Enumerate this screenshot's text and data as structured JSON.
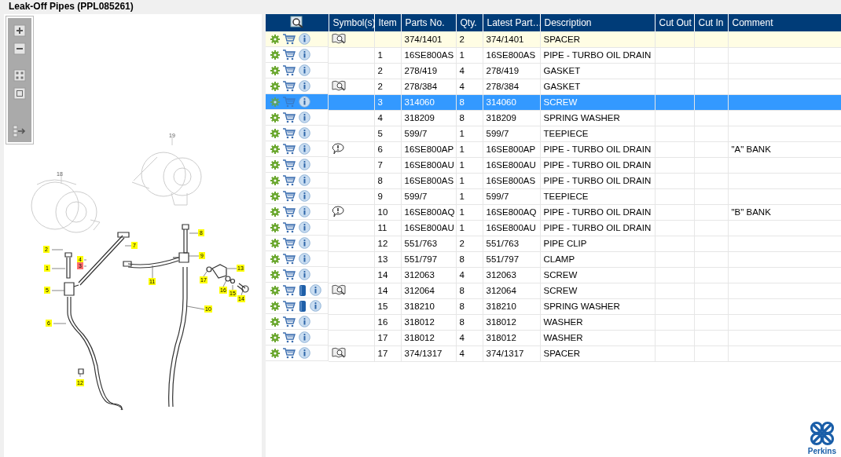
{
  "title": "Leak-Off Pipes (PPL085261)",
  "diagram": {
    "callouts": [
      {
        "label": "18",
        "highlighted": false,
        "selected": false
      },
      {
        "label": "19",
        "highlighted": false,
        "selected": false
      },
      {
        "label": "2",
        "highlighted": true,
        "selected": false
      },
      {
        "label": "4",
        "highlighted": true,
        "selected": false
      },
      {
        "label": "3",
        "highlighted": true,
        "selected": true
      },
      {
        "label": "1",
        "highlighted": true,
        "selected": false
      },
      {
        "label": "7",
        "highlighted": true,
        "selected": false
      },
      {
        "label": "5",
        "highlighted": true,
        "selected": false
      },
      {
        "label": "6",
        "highlighted": true,
        "selected": false
      },
      {
        "label": "12",
        "highlighted": true,
        "selected": false
      },
      {
        "label": "8",
        "highlighted": true,
        "selected": false
      },
      {
        "label": "9",
        "highlighted": true,
        "selected": false
      },
      {
        "label": "11",
        "highlighted": true,
        "selected": false
      },
      {
        "label": "13",
        "highlighted": true,
        "selected": false
      },
      {
        "label": "17",
        "highlighted": true,
        "selected": false
      },
      {
        "label": "16",
        "highlighted": true,
        "selected": false
      },
      {
        "label": "15",
        "highlighted": true,
        "selected": false
      },
      {
        "label": "14",
        "highlighted": true,
        "selected": false
      },
      {
        "label": "10",
        "highlighted": true,
        "selected": false
      }
    ]
  },
  "table": {
    "columns": [
      "Symbol(s)",
      "Item",
      "Parts No.",
      "Qty.",
      "Latest Part…",
      "Description",
      "Cut Out",
      "Cut In",
      "Comment"
    ],
    "rows": [
      {
        "highlighted": true,
        "selected": false,
        "manual": false,
        "symbols": [
          {
            "kind": "book"
          }
        ],
        "part_no": "374/1401",
        "qty": "2",
        "latest_part": "374/1401",
        "description": "SPACER"
      },
      {
        "highlighted": false,
        "selected": false,
        "manual": false,
        "item": "1",
        "part_no": "16SE800AS",
        "qty": "1",
        "latest_part": "16SE800AS",
        "description": "PIPE - TURBO OIL DRAIN"
      },
      {
        "highlighted": false,
        "selected": false,
        "manual": false,
        "item": "2",
        "part_no": "278/419",
        "qty": "4",
        "latest_part": "278/419",
        "description": "GASKET"
      },
      {
        "highlighted": false,
        "selected": false,
        "manual": false,
        "symbols": [
          {
            "kind": "book"
          }
        ],
        "item": "2",
        "part_no": "278/384",
        "qty": "4",
        "latest_part": "278/384",
        "description": "GASKET"
      },
      {
        "highlighted": false,
        "selected": true,
        "manual": false,
        "item": "3",
        "part_no": "314060",
        "qty": "8",
        "latest_part": "314060",
        "description": "SCREW"
      },
      {
        "highlighted": false,
        "selected": false,
        "manual": false,
        "item": "4",
        "part_no": "318209",
        "qty": "8",
        "latest_part": "318209",
        "description": "SPRING WASHER"
      },
      {
        "highlighted": false,
        "selected": false,
        "manual": false,
        "item": "5",
        "part_no": "599/7",
        "qty": "1",
        "latest_part": "599/7",
        "description": "TEEPIECE"
      },
      {
        "highlighted": false,
        "selected": false,
        "manual": false,
        "symbols": [
          {
            "kind": "note"
          }
        ],
        "item": "6",
        "part_no": "16SE800AP",
        "qty": "1",
        "latest_part": "16SE800AP",
        "description": "PIPE - TURBO OIL DRAIN",
        "comment": "\"A\" BANK"
      },
      {
        "highlighted": false,
        "selected": false,
        "manual": false,
        "item": "7",
        "part_no": "16SE800AU",
        "qty": "1",
        "latest_part": "16SE800AU",
        "description": "PIPE - TURBO OIL DRAIN"
      },
      {
        "highlighted": false,
        "selected": false,
        "manual": false,
        "item": "8",
        "part_no": "16SE800AS",
        "qty": "1",
        "latest_part": "16SE800AS",
        "description": "PIPE - TURBO OIL DRAIN"
      },
      {
        "highlighted": false,
        "selected": false,
        "manual": false,
        "item": "9",
        "part_no": "599/7",
        "qty": "1",
        "latest_part": "599/7",
        "description": "TEEPIECE"
      },
      {
        "highlighted": false,
        "selected": false,
        "manual": false,
        "symbols": [
          {
            "kind": "note"
          }
        ],
        "item": "10",
        "part_no": "16SE800AQ",
        "qty": "1",
        "latest_part": "16SE800AQ",
        "description": "PIPE - TURBO OIL DRAIN",
        "comment": "\"B\" BANK"
      },
      {
        "highlighted": false,
        "selected": false,
        "manual": false,
        "item": "11",
        "part_no": "16SE800AU",
        "qty": "1",
        "latest_part": "16SE800AU",
        "description": "PIPE - TURBO OIL DRAIN"
      },
      {
        "highlighted": false,
        "selected": false,
        "manual": false,
        "item": "12",
        "part_no": "551/763",
        "qty": "2",
        "latest_part": "551/763",
        "description": "PIPE CLIP"
      },
      {
        "highlighted": false,
        "selected": false,
        "manual": false,
        "item": "13",
        "part_no": "551/797",
        "qty": "8",
        "latest_part": "551/797",
        "description": "CLAMP"
      },
      {
        "highlighted": false,
        "selected": false,
        "manual": false,
        "item": "14",
        "part_no": "312063",
        "qty": "4",
        "latest_part": "312063",
        "description": "SCREW"
      },
      {
        "highlighted": false,
        "selected": false,
        "manual": true,
        "symbols": [
          {
            "kind": "book"
          }
        ],
        "item": "14",
        "part_no": "312064",
        "qty": "8",
        "latest_part": "312064",
        "description": "SCREW"
      },
      {
        "highlighted": false,
        "selected": false,
        "manual": true,
        "item": "15",
        "part_no": "318210",
        "qty": "8",
        "latest_part": "318210",
        "description": "SPRING WASHER"
      },
      {
        "highlighted": false,
        "selected": false,
        "manual": false,
        "item": "16",
        "part_no": "318012",
        "qty": "8",
        "latest_part": "318012",
        "description": "WASHER"
      },
      {
        "highlighted": false,
        "selected": false,
        "manual": false,
        "item": "17",
        "part_no": "318012",
        "qty": "4",
        "latest_part": "318012",
        "description": "WASHER"
      },
      {
        "highlighted": false,
        "selected": false,
        "manual": false,
        "symbols": [
          {
            "kind": "book"
          }
        ],
        "item": "17",
        "part_no": "374/1317",
        "qty": "4",
        "latest_part": "374/1317",
        "description": "SPACER"
      }
    ]
  },
  "logo": {
    "text": "Perkins"
  }
}
